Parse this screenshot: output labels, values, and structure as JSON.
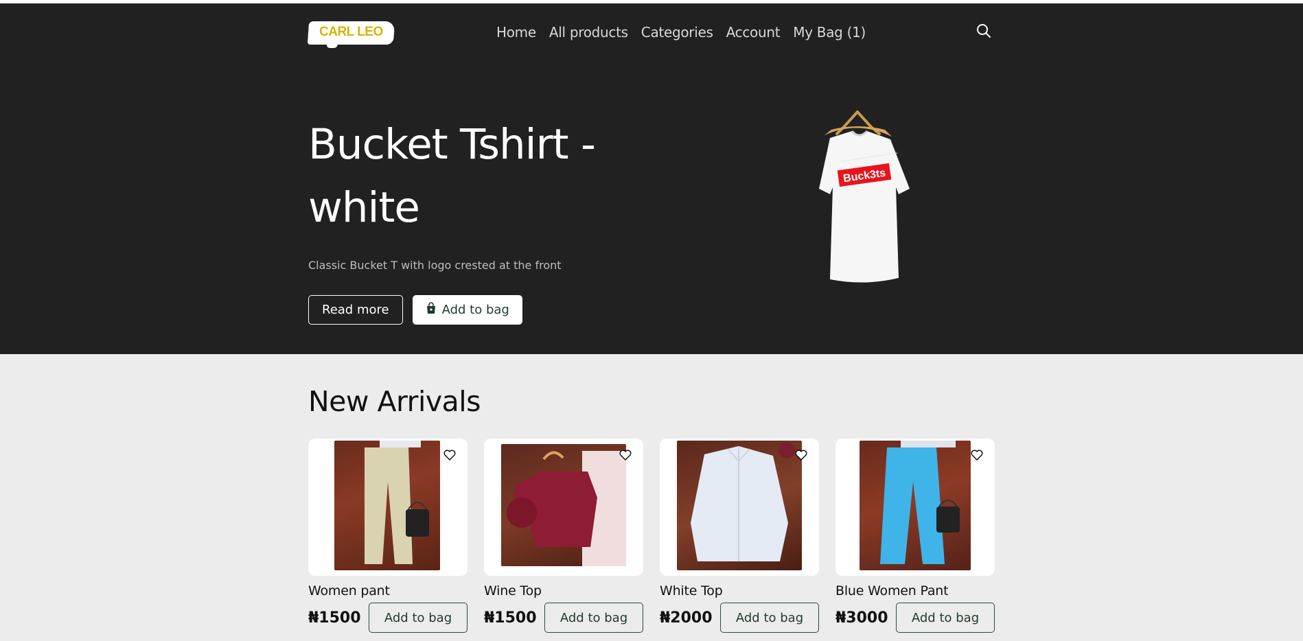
{
  "brand": {
    "logo_text": "CARL LEO"
  },
  "nav": {
    "items": [
      {
        "label": "Home"
      },
      {
        "label": "All products"
      },
      {
        "label": "Categories"
      },
      {
        "label": "Account"
      },
      {
        "label": "My Bag (1)"
      }
    ],
    "search_icon": "search-icon"
  },
  "hero": {
    "title_line1": "Bucket Tshirt -",
    "title_line2": "white",
    "description": "Classic Bucket T with logo crested at the front",
    "read_more_label": "Read more",
    "add_to_bag_label": "Add to bag",
    "shirt_print": "Buck3ts"
  },
  "arrivals": {
    "heading": "New Arrivals",
    "products": [
      {
        "name": "Women pant",
        "price": "₦1500",
        "button": "Add to bag"
      },
      {
        "name": "Wine Top",
        "price": "₦1500",
        "button": "Add to bag"
      },
      {
        "name": "White Top",
        "price": "₦2000",
        "button": "Add to bag"
      },
      {
        "name": "Blue Women Pant",
        "price": "₦3000",
        "button": "Add to bag"
      }
    ]
  },
  "colors": {
    "hero_bg": "#212121",
    "page_bg": "#ececec",
    "logo_text": "#d4b400",
    "button_text": "#1f3b2c",
    "shirt_logo": "#e8141c"
  }
}
